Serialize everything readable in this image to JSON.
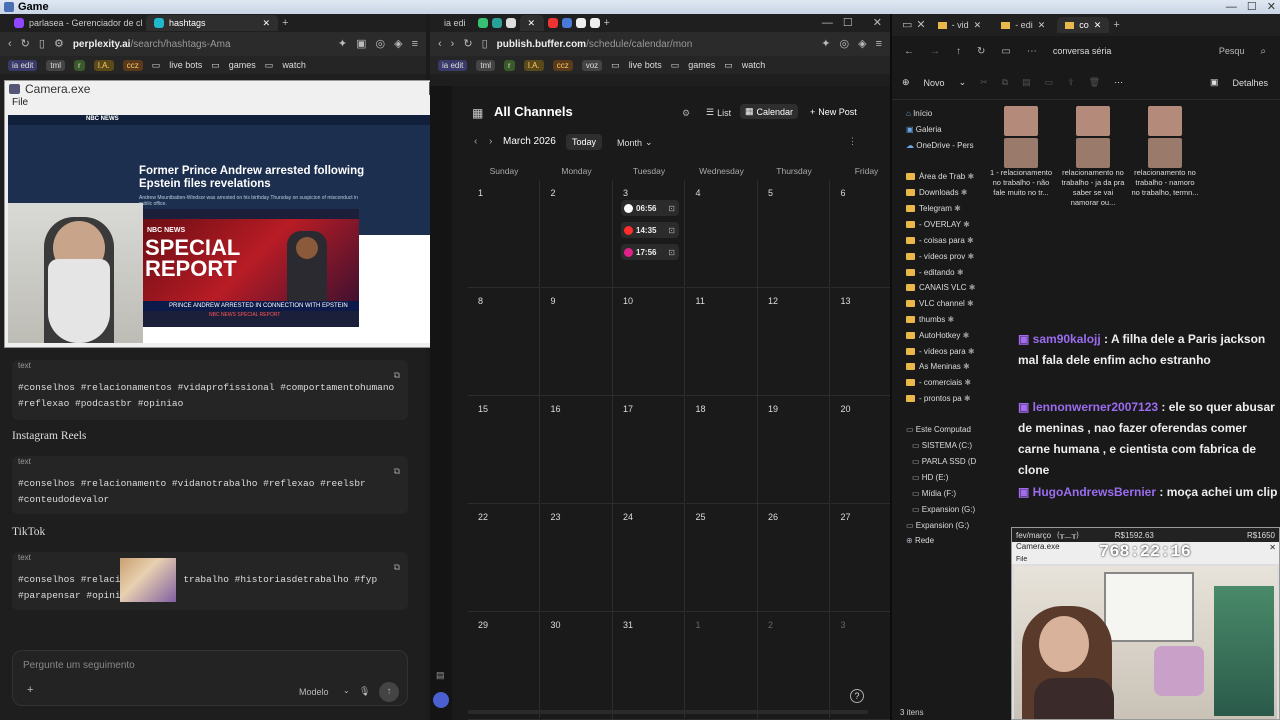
{
  "window_title": "Game",
  "left_browser": {
    "tabs": [
      {
        "label": "parlasea - Gerenciador de clip",
        "color": "#9146ff"
      },
      {
        "label": "hashtags",
        "color": "#20b8cd"
      }
    ],
    "url_domain": "perplexity.ai",
    "url_path": "/search/hashtags-Ama",
    "bookmarks": [
      "ia edit",
      "tml",
      "r",
      "I.A.",
      "ccz",
      "live bots",
      "games",
      "watch"
    ]
  },
  "camera_window": {
    "title": "Camera.exe",
    "menu_file": "File",
    "news_brand": "NBC NEWS",
    "headline": "Former Prince Andrew arrested following Epstein files revelations",
    "sub_headline": "Andrew Mountbatten-Windsor was arrested on his birthday Thursday on suspicion of misconduct in public office.",
    "special_report_line1": "SPECIAL",
    "special_report_line2": "REPORT",
    "ticker": "PRINCE ANDREW ARRESTED IN CONNECTION WITH EPSTEIN",
    "ticker_badge": "NBC NEWS SPECIAL REPORT"
  },
  "perplexity": {
    "blocks": [
      {
        "label": "text",
        "line1": "#conselhos #relacionamentos #vidaprofissional #comportamentohumano",
        "line2": "#reflexao #podcastbr #opiniao"
      },
      {
        "heading": "Instagram Reels",
        "label": "text",
        "line1": "#conselhos #relacionamento #vidanotrabalho #reflexao #reelsbr",
        "line2": "#conteudodevalor"
      },
      {
        "heading": "TikTok",
        "label": "text",
        "line1": "#conselhos #relacio          trabalho #historiasdetrabalho #fyp",
        "line2": "#parapensar #opiniao"
      }
    ],
    "followup_placeholder": "Pergunte um seguimento",
    "model_label": "Modelo"
  },
  "mid_browser": {
    "tabs": [
      {
        "label": "ia edi"
      }
    ],
    "url_domain": "publish.buffer.com",
    "url_path": "/schedule/calendar/mon",
    "bookmarks": [
      "ia edit",
      "tml",
      "r",
      "I.A.",
      "ccz",
      "voz",
      "live bots",
      "games",
      "watch"
    ]
  },
  "calendar": {
    "channels_title": "All Channels",
    "view_list": "List",
    "view_calendar": "Calendar",
    "new_post": "New Post",
    "month_label": "March 2026",
    "today": "Today",
    "range": "Month",
    "weekdays": [
      "Sunday",
      "Monday",
      "Tuesday",
      "Wednesday",
      "Thursday",
      "Friday"
    ],
    "weeks": [
      [
        "1",
        "2",
        "3",
        "4",
        "5",
        "6"
      ],
      [
        "8",
        "9",
        "10",
        "11",
        "12",
        "13"
      ],
      [
        "15",
        "16",
        "17",
        "18",
        "19",
        "20"
      ],
      [
        "22",
        "23",
        "24",
        "25",
        "26",
        "27"
      ],
      [
        "29",
        "30",
        "31",
        "1",
        "2",
        "3"
      ]
    ],
    "posts": [
      {
        "time": "06:56",
        "color": "#ffffff"
      },
      {
        "time": "14:35",
        "color": "#ff2d2d"
      },
      {
        "time": "17:56",
        "color": "#e0218a"
      }
    ]
  },
  "explorer": {
    "tabs": [
      "- vid",
      "- edi",
      "co"
    ],
    "path": "conversa séria",
    "search": "Pesqu",
    "new_label": "Novo",
    "details_label": "Detalhes",
    "sidebar": [
      "Início",
      "Galeria",
      "OneDrive - Pers",
      "Área de Trab",
      "Downloads",
      "Telegram",
      "- OVERLAY",
      "- coisas para",
      "- vídeos prov",
      "- editando",
      "CANAIS VLC",
      "VLC channel",
      "thumbs",
      "AutoHotkey",
      "- vídeos para",
      "As Meninas",
      "- comerciais",
      "- prontos pa",
      "Este Computad",
      "SISTEMA (C:)",
      "PARLA SSD (D",
      "HD (E:)",
      "Mídia (F:)",
      "Expansion (G:)",
      "Expansion (G:)",
      "Rede"
    ],
    "files": [
      "1 - relacionamento no trabalho - não fale muito no tr...",
      "relacionamento no trabalho - ja da pra saber se vai namorar ou...",
      "relacionamento no trabalho - namoro no trabalho, termn..."
    ],
    "status": "3 itens"
  },
  "chat": [
    {
      "user": "sam90kalojj",
      "msg": ": A filha dele a Paris jackson mal fala dele enfim acho estranho"
    },
    {
      "user": "lennonwerner2007123",
      "msg": ": ele so quer abusar de meninas , nao fazer oferendas comer carne humana , e cientista com fabrica de clone"
    },
    {
      "user": "HugoAndrewsBernier",
      "msg": ": moça achei um clip"
    }
  ],
  "webcam": {
    "goal_label": "fev/março",
    "goal_value": "R$1592.63",
    "goal_target": "R$1650",
    "timer": "768:22:16",
    "title": "Camera.exe",
    "menu": "File"
  }
}
